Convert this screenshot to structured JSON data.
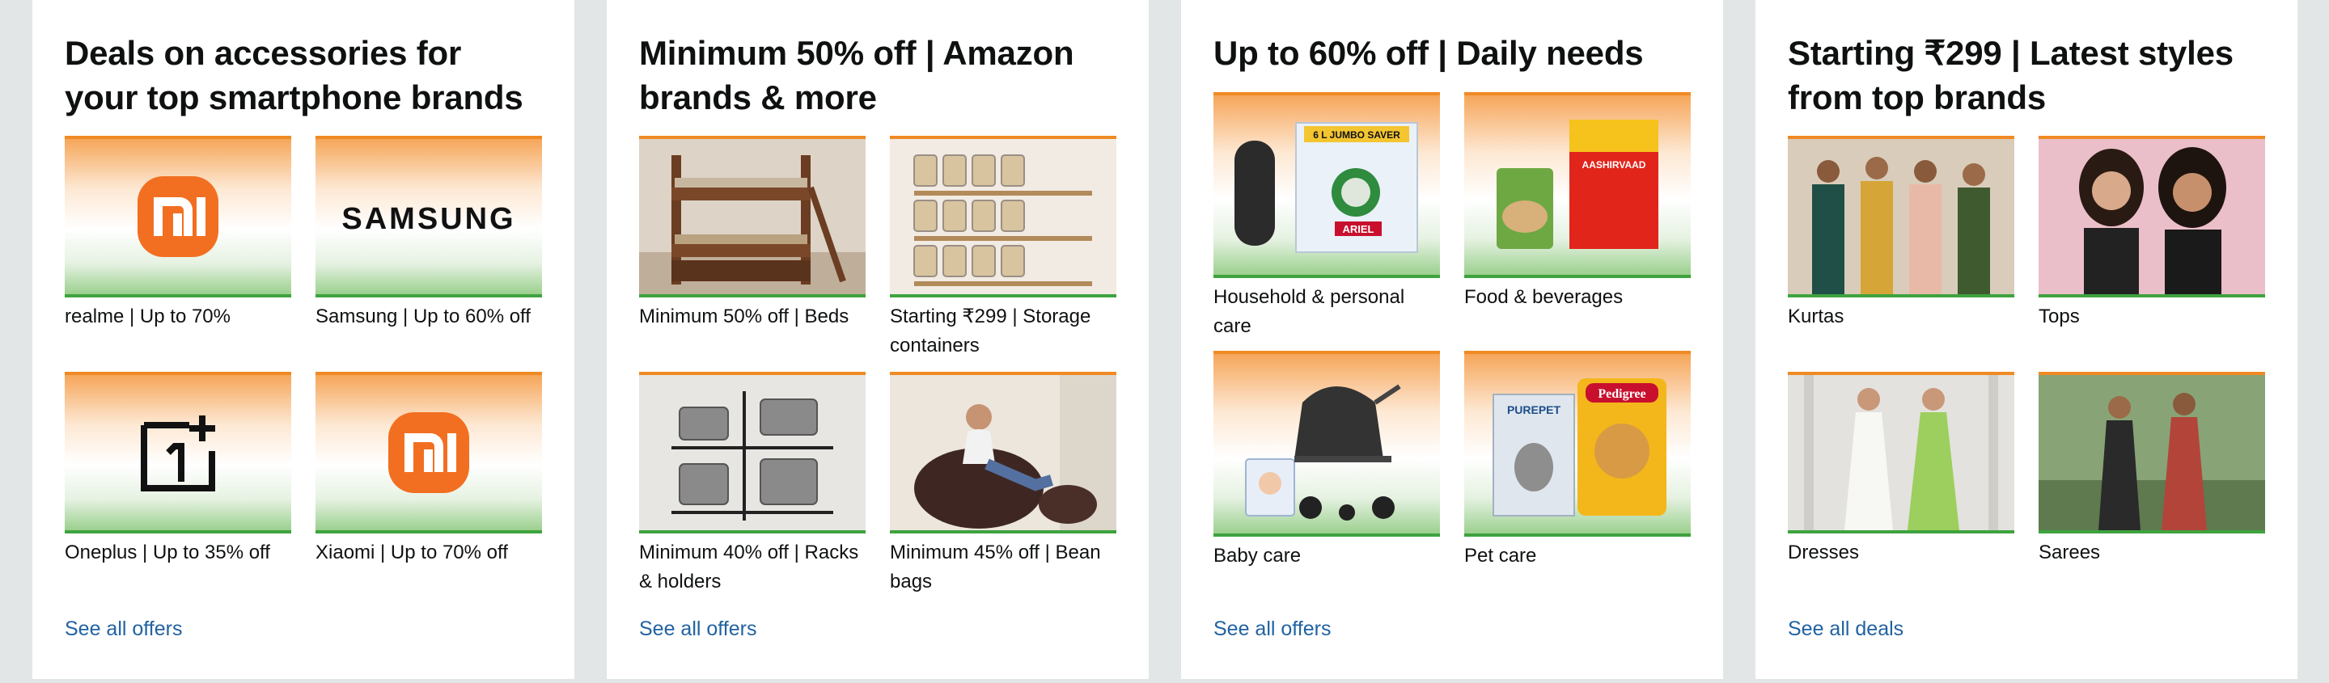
{
  "cards": [
    {
      "title": "Deals on accessories for your top smartphone brands",
      "link": "See all offers",
      "tiles": [
        {
          "label": "realme | Up to 70%",
          "brand": "mi-logo"
        },
        {
          "label": "Samsung | Up to 60% off",
          "brand": "SAMSUNG"
        },
        {
          "label": "Oneplus | Up to 35% off",
          "brand": "oneplus-logo"
        },
        {
          "label": "Xiaomi | Up to 70% off",
          "brand": "mi-logo"
        }
      ]
    },
    {
      "title": "Minimum 50% off | Amazon brands & more",
      "link": "See all offers",
      "tiles": [
        {
          "label": "Minimum 50% off | Beds"
        },
        {
          "label": "Starting ₹299 | Storage containers"
        },
        {
          "label": "Minimum 40% off | Racks & holders"
        },
        {
          "label": "Minimum 45% off | Bean bags"
        }
      ]
    },
    {
      "title": "Up to 60% off | Daily needs",
      "link": "See all offers",
      "tiles": [
        {
          "label": "Household & personal care",
          "product_text": "6 L JUMBO SAVER",
          "product_brand": "ARIEL"
        },
        {
          "label": "Food & beverages",
          "product_text": "AASHIRVAAD"
        },
        {
          "label": "Baby care"
        },
        {
          "label": "Pet care",
          "product_text": "PUREPET",
          "product_brand": "Pedigree"
        }
      ]
    },
    {
      "title": "Starting ₹299 | Latest styles from top brands",
      "link": "See all deals",
      "tiles": [
        {
          "label": "Kurtas"
        },
        {
          "label": "Tops"
        },
        {
          "label": "Dresses"
        },
        {
          "label": "Sarees"
        }
      ]
    }
  ],
  "colors": {
    "link": "#2162a1",
    "mi_orange": "#f26f21",
    "tile_border_top": "#f08a24",
    "tile_border_bottom": "#3ea33e"
  }
}
